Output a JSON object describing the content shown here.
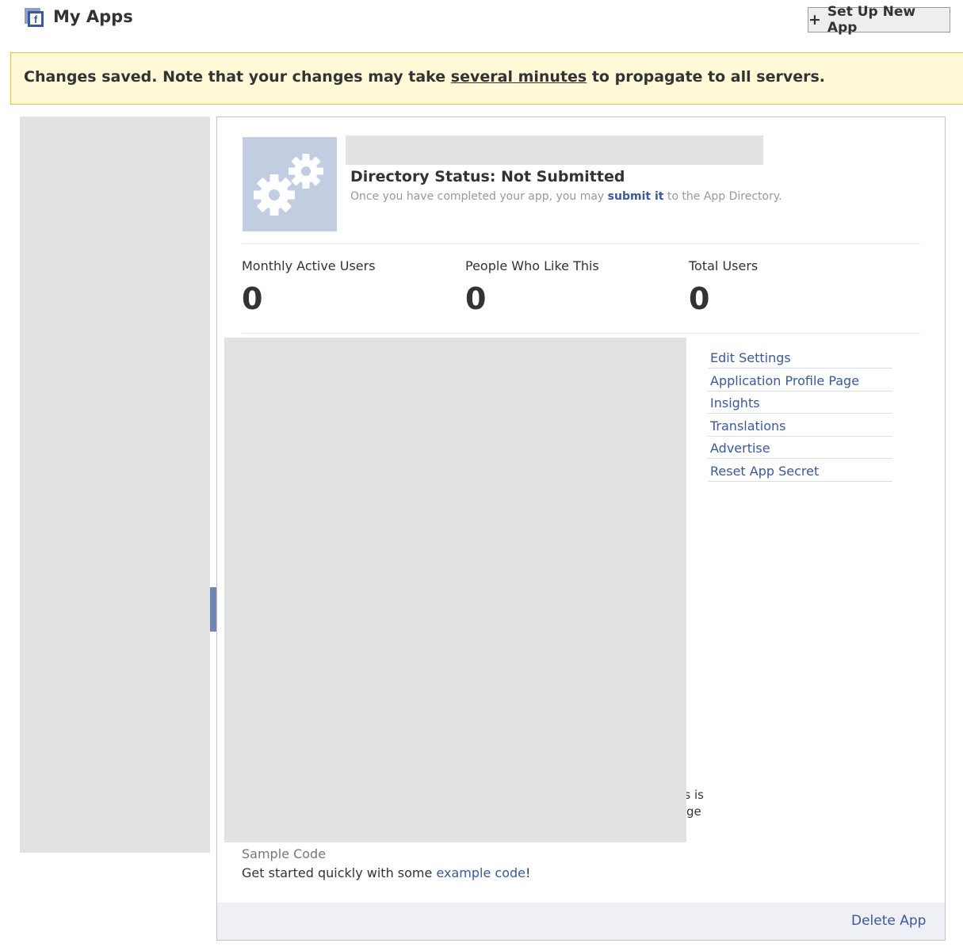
{
  "header": {
    "title": "My Apps",
    "setup_button_icon": "+",
    "setup_button_label": "Set Up New App"
  },
  "notice": {
    "text_before": "Changes saved. Note that your changes may take ",
    "link_text": "several minutes",
    "text_after": " to propagate to all servers."
  },
  "app": {
    "directory_status": "Directory Status: Not Submitted",
    "note_before": "Once you have completed your app, you may ",
    "note_link": "submit it",
    "note_after": " to the App Directory."
  },
  "stats": [
    {
      "label": "Monthly Active Users",
      "value": "0"
    },
    {
      "label": "People Who Like This",
      "value": "0"
    },
    {
      "label": "Total Users",
      "value": "0"
    }
  ],
  "links": [
    "Edit Settings",
    "Application Profile Page",
    "Insights",
    "Translations",
    "Advertise",
    "Reset App Secret"
  ],
  "fragments": [
    "s is",
    "ge"
  ],
  "sample": {
    "heading": "Sample Code",
    "text_before": "Get started quickly with some ",
    "link": "example code",
    "text_after": "!"
  },
  "footer": {
    "delete_label": "Delete App"
  },
  "colors": {
    "link": "#3b5998",
    "notice_bg": "#fff9d7",
    "notice_border": "#e2c822",
    "placeholder": "#e3e2e2",
    "app_icon_bg": "#c3cde2"
  },
  "icons": {
    "header": "apps-icon",
    "app": "gears-icon"
  }
}
